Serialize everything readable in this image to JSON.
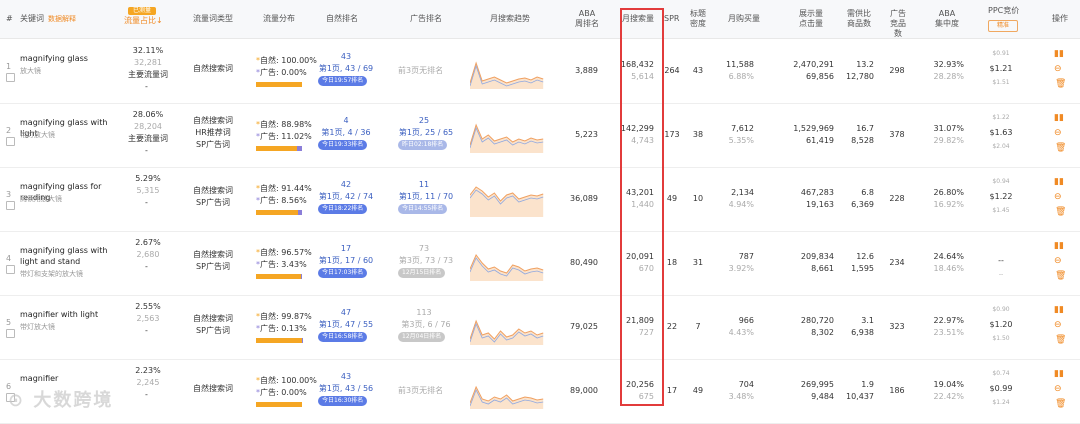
{
  "header": {
    "num": "#",
    "keyword": "关键词",
    "keyword_link": "数据解释",
    "share_badge": "已测量",
    "share": "流量占比",
    "type": "流量词类型",
    "dist": "流量分布",
    "natural": "自然排名",
    "ad": "广告排名",
    "trend": "月搜索趋势",
    "aba": "ABA 周排名",
    "monthly": "月搜索量",
    "spr": "SPR",
    "title_density": "标题 密度",
    "monthly_buy": "月购买量",
    "display_click": "展示量 点击量",
    "supply_demand": "需供比 商品数",
    "ad_count": "广告 竞品数",
    "aba_conc": "ABA 集中度",
    "ppc": "PPC竞价",
    "ppc_filter": "精准",
    "action": "操作"
  },
  "rows": [
    {
      "idx": "1",
      "kw": "magnifying glass",
      "kw_cn": "放大镜",
      "share": "32.11%",
      "share_sub": "32,281",
      "share_type": "主要流量词",
      "share_extra": "-",
      "type": [
        "自然搜索词"
      ],
      "nat_pct": "100.00%",
      "ad_pct": "0.00%",
      "nat_fill": 100,
      "nat_rank": "43",
      "nat_pos": "第1页, 43 / 69",
      "nat_badge": "今日19:57排名",
      "ad_rank": "",
      "ad_pos": "前3页无排名",
      "ad_badge": "",
      "aba": "3,889",
      "monthly": "168,432",
      "monthly_sub": "5,614",
      "spr": "264",
      "title": "43",
      "buy": "11,588",
      "buy_pct": "6.88%",
      "display": "2,470,291",
      "click": "69,856",
      "sd": "13.2",
      "goods": "12,780",
      "adc": "298",
      "conc": "32.93%",
      "conc_sub": "28.28%",
      "ppc_lo": "$0.91",
      "ppc": "$1.21",
      "ppc_hi": "$1.51"
    },
    {
      "idx": "2",
      "kw": "magnifying glass with light",
      "kw_cn": "带灯放大镜",
      "share": "28.06%",
      "share_sub": "28,204",
      "share_type": "主要流量词",
      "share_extra": "-",
      "type": [
        "自然搜索词",
        "HR推荐词",
        "SP广告词"
      ],
      "nat_pct": "88.98%",
      "ad_pct": "11.02%",
      "nat_fill": 89,
      "nat_rank": "4",
      "nat_pos": "第1页, 4 / 36",
      "nat_badge": "今日19:33排名",
      "ad_rank": "25",
      "ad_pos": "第1页, 25 / 65",
      "ad_badge": "昨日02:18排名",
      "aba": "5,223",
      "monthly": "142,299",
      "monthly_sub": "4,743",
      "spr": "173",
      "title": "38",
      "buy": "7,612",
      "buy_pct": "5.35%",
      "display": "1,529,969",
      "click": "61,419",
      "sd": "16.7",
      "goods": "8,528",
      "adc": "378",
      "conc": "31.07%",
      "conc_sub": "29.82%",
      "ppc_lo": "$1.22",
      "ppc": "$1.63",
      "ppc_hi": "$2.04"
    },
    {
      "idx": "3",
      "kw": "magnifying glass for reading",
      "kw_cn": "阅读用放大镜",
      "share": "5.29%",
      "share_sub": "5,315",
      "share_type": "",
      "share_extra": "-",
      "type": [
        "自然搜索词",
        "SP广告词"
      ],
      "nat_pct": "91.44%",
      "ad_pct": "8.56%",
      "nat_fill": 91,
      "nat_rank": "42",
      "nat_pos": "第1页, 42 / 74",
      "nat_badge": "今日18:22排名",
      "ad_rank": "11",
      "ad_pos": "第1页, 11 / 70",
      "ad_badge": "今日14:55排名",
      "aba": "36,089",
      "monthly": "43,201",
      "monthly_sub": "1,440",
      "spr": "49",
      "title": "10",
      "buy": "2,134",
      "buy_pct": "4.94%",
      "display": "467,283",
      "click": "19,163",
      "sd": "6.8",
      "goods": "6,369",
      "adc": "228",
      "conc": "26.80%",
      "conc_sub": "16.92%",
      "ppc_lo": "$0.94",
      "ppc": "$1.22",
      "ppc_hi": "$1.45"
    },
    {
      "idx": "4",
      "kw": "magnifying glass with light and stand",
      "kw_cn": "带灯和支架的放大镜",
      "share": "2.67%",
      "share_sub": "2,680",
      "share_type": "",
      "share_extra": "-",
      "type": [
        "自然搜索词",
        "SP广告词"
      ],
      "nat_pct": "96.57%",
      "ad_pct": "3.43%",
      "nat_fill": 97,
      "nat_rank": "17",
      "nat_pos": "第1页, 17 / 60",
      "nat_badge": "今日17:03排名",
      "ad_rank": "73",
      "ad_pos": "第3页, 73 / 73",
      "ad_badge": "12月15日排名",
      "ad_gray": true,
      "aba": "80,490",
      "monthly": "20,091",
      "monthly_sub": "670",
      "spr": "18",
      "title": "31",
      "buy": "787",
      "buy_pct": "3.92%",
      "display": "209,834",
      "click": "8,661",
      "sd": "12.6",
      "goods": "1,595",
      "adc": "234",
      "conc": "24.64%",
      "conc_sub": "18.46%",
      "ppc_lo": "",
      "ppc": "--",
      "ppc_hi": "--"
    },
    {
      "idx": "5",
      "kw": "magnifier with light",
      "kw_cn": "带灯放大镜",
      "share": "2.55%",
      "share_sub": "2,563",
      "share_type": "",
      "share_extra": "-",
      "type": [
        "自然搜索词",
        "SP广告词"
      ],
      "nat_pct": "99.87%",
      "ad_pct": "0.13%",
      "nat_fill": 99,
      "nat_rank": "47",
      "nat_pos": "第1页, 47 / 55",
      "nat_badge": "今日16:58排名",
      "ad_rank": "113",
      "ad_pos": "第3页, 6 / 76",
      "ad_badge": "12月04日排名",
      "ad_gray": true,
      "aba": "79,025",
      "monthly": "21,809",
      "monthly_sub": "727",
      "spr": "22",
      "title": "7",
      "buy": "966",
      "buy_pct": "4.43%",
      "display": "280,720",
      "click": "8,302",
      "sd": "3.1",
      "goods": "6,938",
      "adc": "323",
      "conc": "22.97%",
      "conc_sub": "23.51%",
      "ppc_lo": "$0.90",
      "ppc": "$1.20",
      "ppc_hi": "$1.50"
    },
    {
      "idx": "6",
      "kw": "magnifier",
      "kw_cn": "",
      "share": "2.23%",
      "share_sub": "2,245",
      "share_type": "",
      "share_extra": "-",
      "type": [
        "自然搜索词"
      ],
      "nat_pct": "100.00%",
      "ad_pct": "0.00%",
      "nat_fill": 100,
      "nat_rank": "43",
      "nat_pos": "第1页, 43 / 56",
      "nat_badge": "今日16:30排名",
      "ad_rank": "",
      "ad_pos": "前3页无排名",
      "ad_badge": "",
      "aba": "89,000",
      "monthly": "20,256",
      "monthly_sub": "675",
      "spr": "17",
      "title": "49",
      "buy": "704",
      "buy_pct": "3.48%",
      "display": "269,995",
      "click": "9,484",
      "sd": "1.9",
      "goods": "10,437",
      "adc": "186",
      "conc": "19.04%",
      "conc_sub": "22.42%",
      "ppc_lo": "$0.74",
      "ppc": "$0.99",
      "ppc_hi": "$1.24"
    }
  ],
  "labels": {
    "natural_prefix": "自然:",
    "ad_prefix": "广告:"
  },
  "watermark": "大数跨境"
}
